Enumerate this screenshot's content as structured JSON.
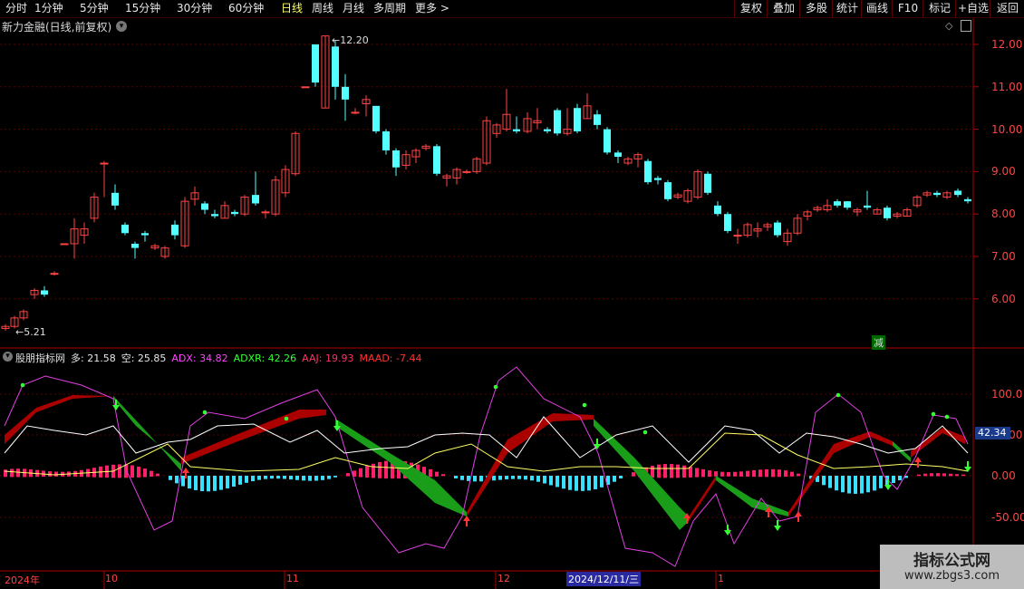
{
  "toolbar": {
    "periods": [
      "分时",
      "1分钟",
      "5分钟",
      "15分钟",
      "30分钟",
      "60分钟",
      "日线",
      "周线",
      "月线",
      "多周期",
      "更多 >"
    ],
    "active_period": "日线",
    "buttons": [
      "复权",
      "叠加",
      "多股",
      "统计",
      "画线",
      "F10",
      "标记",
      "+自选",
      "返回"
    ]
  },
  "main_chart": {
    "title": "新力金融(日线,前复权)",
    "high_label": "12.20",
    "low_label": "5.21",
    "y_ticks": [
      "12.00",
      "11.00",
      "10.00",
      "9.00",
      "8.00",
      "7.00",
      "6.00"
    ],
    "badge": "减",
    "colors": {
      "up": "#ff4444",
      "down": "#54ffff",
      "axis": "#b00000"
    }
  },
  "indicator": {
    "name": "股朋指标网",
    "values": [
      {
        "label": "多: 21.58",
        "color": "#e8e8e8"
      },
      {
        "label": "空: 25.85",
        "color": "#e8e8e8"
      },
      {
        "label": "ADX: 34.82",
        "color": "#ff44ff"
      },
      {
        "label": "ADXR: 42.26",
        "color": "#33ff33"
      },
      {
        "label": "AAJ: 19.93",
        "color": "#ff3366"
      },
      {
        "label": "MAAD: -7.44",
        "color": "#ff3333"
      }
    ],
    "y_ticks": [
      "100.0",
      "50.00",
      "0.00",
      "-50.00"
    ],
    "current_value": "42.34"
  },
  "xaxis": {
    "labels": [
      "2024年",
      "10",
      "11",
      "12",
      "2024/12/11/三",
      "1"
    ]
  },
  "watermark": {
    "title": "指标公式网",
    "url": "www.zbgs3.com"
  }
}
